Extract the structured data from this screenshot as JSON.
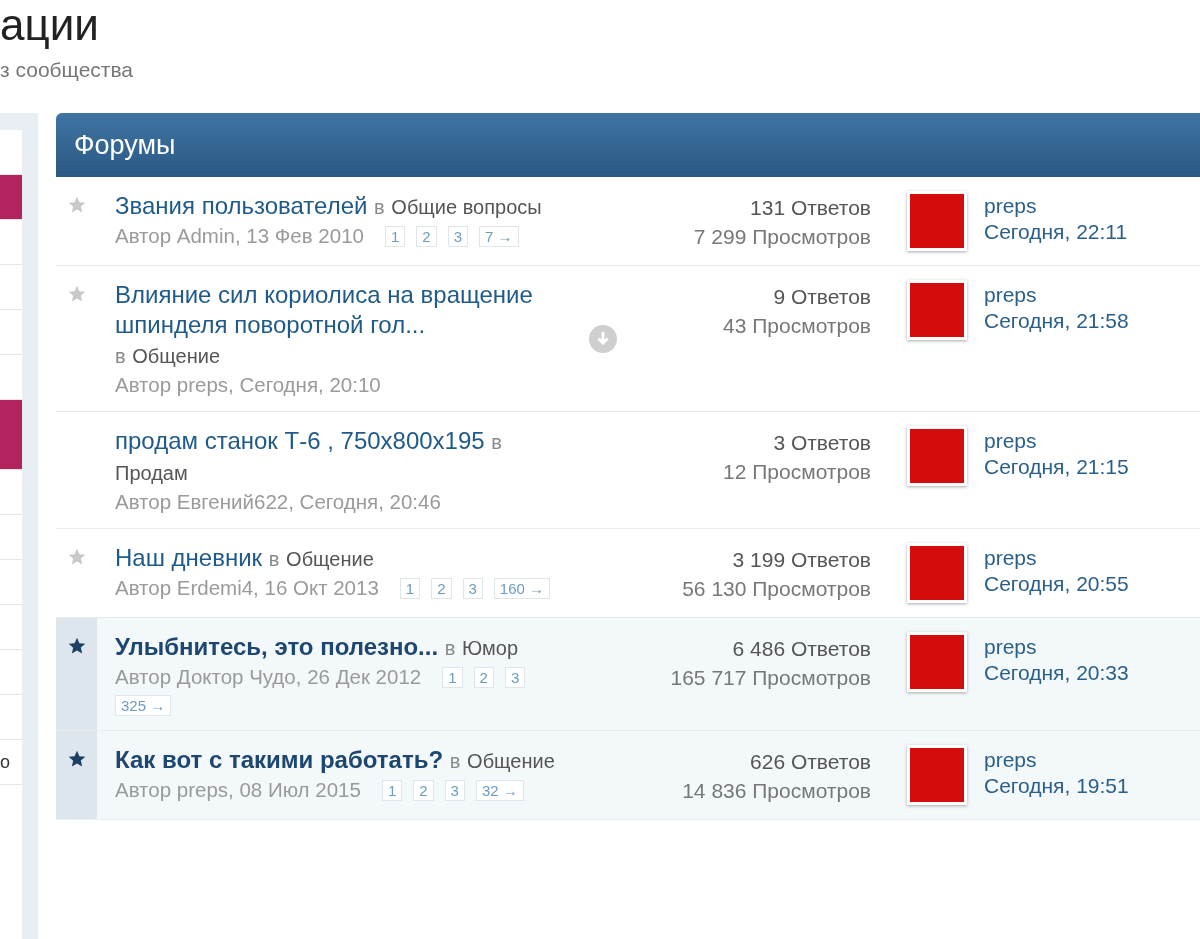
{
  "page": {
    "title": "ации",
    "subtitle": "з сообщества"
  },
  "sidebar": {
    "items": [
      {
        "selected": false
      },
      {
        "selected": true
      },
      {
        "selected": false
      },
      {
        "selected": false
      },
      {
        "selected": false
      },
      {
        "selected": false
      },
      {
        "selected": true
      },
      {
        "selected": false
      },
      {
        "selected": false
      },
      {
        "selected": false
      },
      {
        "selected": false
      },
      {
        "selected": false
      },
      {
        "selected": false
      },
      {
        "selected": false,
        "label": "о"
      }
    ]
  },
  "forum_block": {
    "title": "Форумы",
    "threads": [
      {
        "title": "Звания пользователей",
        "sticky": false,
        "has_star": true,
        "in": "в",
        "forum": "Общие вопросы",
        "author": "Автор Admin, 13 Фев 2010",
        "pages": [
          "1",
          "2",
          "3",
          "7 →"
        ],
        "unread_icon": false,
        "replies": "131 Ответов",
        "views": "7 299 Просмотров",
        "last_user": "preps",
        "last_time": "Сегодня, 22:11"
      },
      {
        "title": "Влияние сил кориолиса на вращение шпинделя поворотной гол...",
        "sticky": false,
        "has_star": true,
        "in": "в",
        "forum": "Общение",
        "author": "Автор preps, Сегодня, 20:10",
        "unread_icon": true,
        "replies": "9 Ответов",
        "views": "43 Просмотров",
        "last_user": "preps",
        "last_time": "Сегодня, 21:58"
      },
      {
        "title": "продам станок Т-6 , 750х800х195",
        "sticky": false,
        "has_star": false,
        "in": "в",
        "forum": "Продам",
        "author": "Автор Евгений622, Сегодня, 20:46",
        "unread_icon": false,
        "replies": "3 Ответов",
        "views": "12 Просмотров",
        "last_user": "preps",
        "last_time": "Сегодня, 21:15"
      },
      {
        "title": "Наш дневник",
        "sticky": false,
        "has_star": true,
        "in": "в",
        "forum": "Общение",
        "author": "Автор Erdemi4, 16 Окт 2013",
        "pages": [
          "1",
          "2",
          "3",
          "160 →"
        ],
        "unread_icon": false,
        "replies": "3 199 Ответов",
        "views": "56 130 Просмотров",
        "last_user": "preps",
        "last_time": "Сегодня, 20:55"
      },
      {
        "title": "Улыбнитесь, это полезно...",
        "sticky": true,
        "has_star": true,
        "in": "в",
        "forum": "Юмор",
        "author": "Автор Доктор Чудо, 26 Дек 2012",
        "pages": [
          "1",
          "2",
          "3",
          "325 →"
        ],
        "unread_icon": false,
        "replies": "6 486 Ответов",
        "views": "165 717 Просмотров",
        "last_user": "preps",
        "last_time": "Сегодня, 20:33"
      },
      {
        "title": "Как вот с такими работать?",
        "sticky": true,
        "has_star": true,
        "in": "в",
        "forum": "Общение",
        "author": "Автор preps, 08 Июл 2015",
        "pages": [
          "1",
          "2",
          "3",
          "32 →"
        ],
        "unread_icon": false,
        "replies": "626 Ответов",
        "views": "14 836 Просмотров",
        "last_user": "preps",
        "last_time": "Сегодня, 19:51"
      }
    ]
  }
}
